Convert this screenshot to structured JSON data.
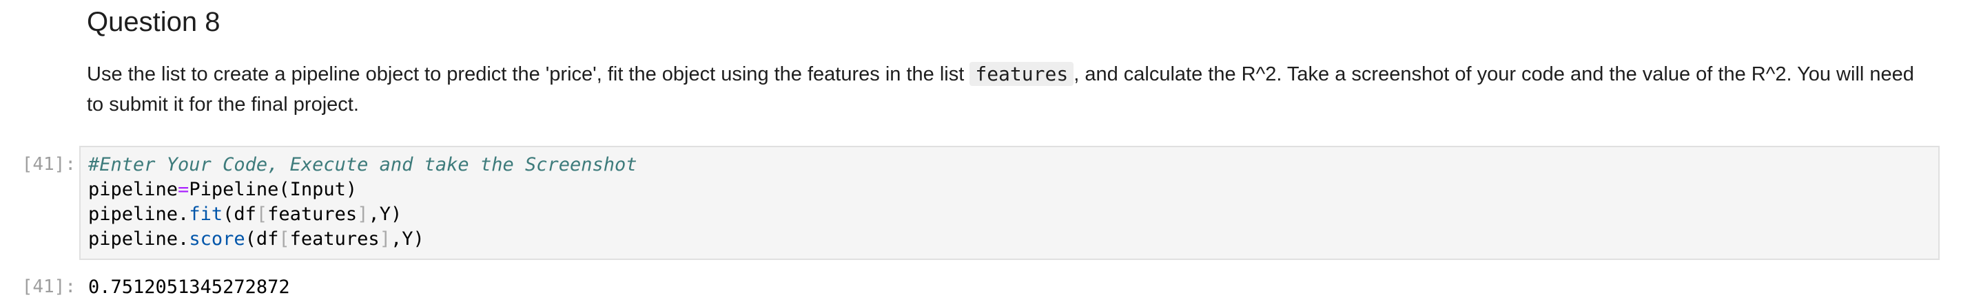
{
  "markdown": {
    "heading": "Question 8",
    "text_before_code": "Use the list to create a pipeline object to predict the 'price', fit the object using the features in the list ",
    "inline_code": "features",
    "text_after_code": ", and calculate the R^2. Take a screenshot of your code and the value of the R^2. You will need to submit it for the final project."
  },
  "code_cell": {
    "input_prompt": "[41]:",
    "comment": "#Enter Your Code, Execute and take the Screenshot",
    "line2": {
      "var": "pipeline",
      "op": "=",
      "rhs": "Pipeline(Input)"
    },
    "line3": {
      "obj": "pipeline",
      "dot": ".",
      "method": "fit",
      "arg_open": "(df",
      "bracket_open": "[",
      "arg_inner": "features",
      "bracket_close": "]",
      "arg_close": ",Y)"
    },
    "line4": {
      "obj": "pipeline",
      "dot": ".",
      "method": "score",
      "arg_open": "(df",
      "bracket_open": "[",
      "arg_inner": "features",
      "bracket_close": "]",
      "arg_close": ",Y)"
    }
  },
  "output_cell": {
    "output_prompt": "[41]:",
    "value": "0.7512051345272872"
  }
}
